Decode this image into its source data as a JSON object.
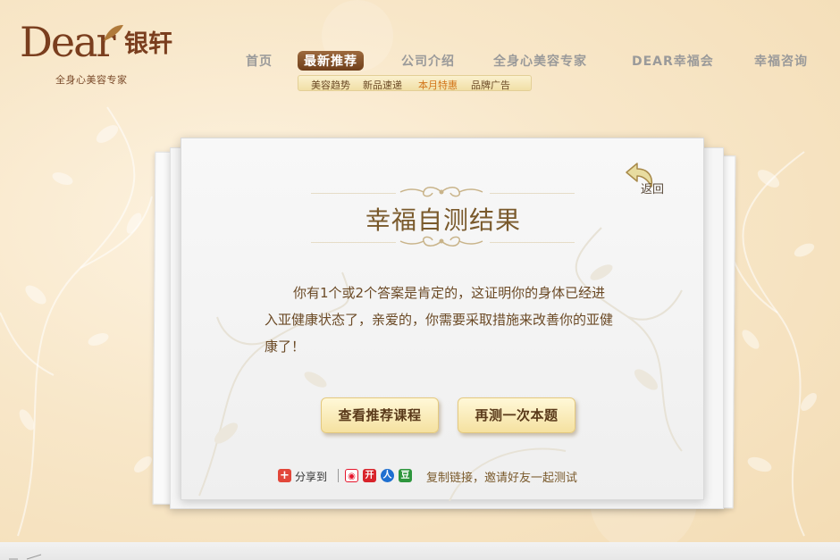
{
  "brand": {
    "logo_word": "Dear",
    "logo_cn": "银轩",
    "tagline": "全身心美容专家"
  },
  "nav": {
    "items": [
      {
        "label": "首页",
        "active": false
      },
      {
        "label": "最新推荐",
        "active": true
      },
      {
        "label": "公司介绍",
        "active": false
      },
      {
        "label": "全身心美容专家",
        "active": false
      },
      {
        "label": "DEAR幸福会",
        "active": false
      },
      {
        "label": "幸福咨询",
        "active": false
      }
    ],
    "subnav": [
      {
        "label": "美容趋势",
        "highlight": false
      },
      {
        "label": "新品速递",
        "highlight": false
      },
      {
        "label": "本月特惠",
        "highlight": true
      },
      {
        "label": "品牌广告",
        "highlight": false
      }
    ]
  },
  "card": {
    "back_label": "返回",
    "title": "幸福自测结果",
    "result_text": "你有1个或2个答案是肯定的，这证明你的身体已经进入亚健康状态了，亲爱的，你需要采取措施来改善你的亚健康了！",
    "buttons": {
      "courses": "查看推荐课程",
      "retake": "再测一次本题"
    },
    "share": {
      "label": "分享到",
      "plus_glyph": "+",
      "icons": [
        {
          "name": "weibo-icon",
          "glyph": "◉",
          "color": "#e6162d"
        },
        {
          "name": "kaixin-icon",
          "glyph": "开",
          "color": "#d8232a"
        },
        {
          "name": "renren-icon",
          "glyph": "人",
          "color": "#1e6fd0"
        },
        {
          "name": "douban-icon",
          "glyph": "豆",
          "color": "#2e963d"
        }
      ],
      "copy_link": "复制链接，邀请好友一起测试"
    }
  },
  "colors": {
    "accent_brown": "#7a3e1e",
    "nav_active": "#8a5530",
    "button_gold": "#f5e1a0"
  }
}
